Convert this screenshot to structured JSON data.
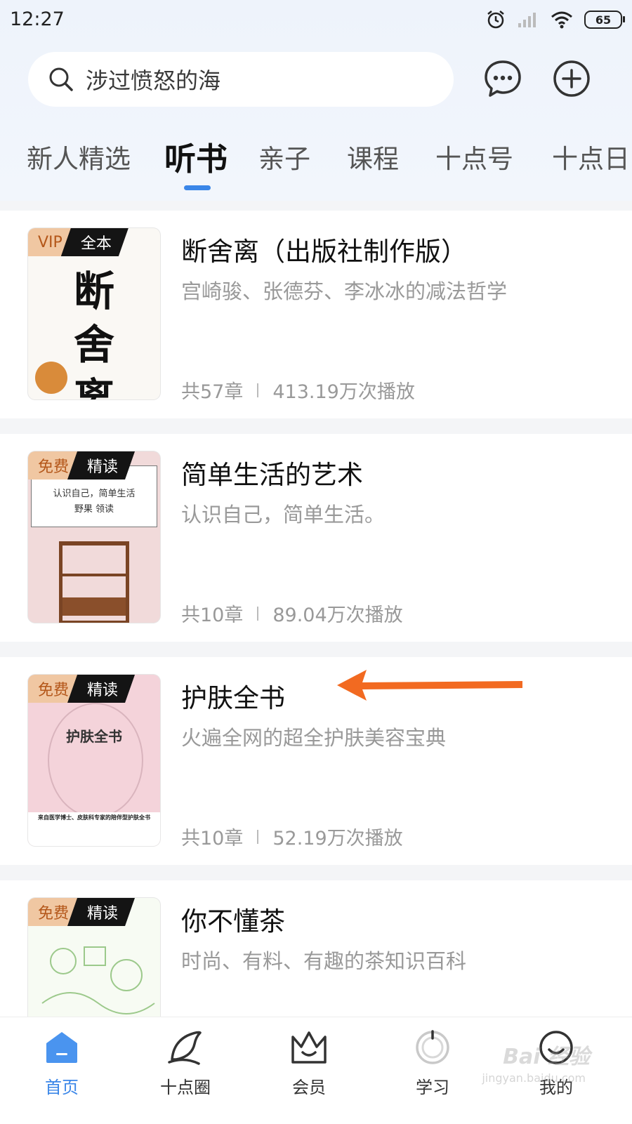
{
  "status_bar": {
    "time": "12:27",
    "battery": "65"
  },
  "search": {
    "placeholder": "涉过愤怒的海"
  },
  "tabs": [
    {
      "label": "新人精选"
    },
    {
      "label": "听书"
    },
    {
      "label": "亲子"
    },
    {
      "label": "课程"
    },
    {
      "label": "十点号"
    },
    {
      "label": "十点日"
    }
  ],
  "books": [
    {
      "title": "断舍离（出版社制作版）",
      "desc": "宫崎骏、张德芬、李冰冰的减法哲学",
      "chapters": "共57章",
      "plays": "413.19万次播放",
      "badge_left": "VIP",
      "badge_right": "全本",
      "cover_text": [
        "断",
        "舍",
        "离"
      ]
    },
    {
      "title": "简单生活的艺术",
      "desc": "认识自己，简单生活。",
      "chapters": "共10章",
      "plays": "89.04万次播放",
      "badge_left": "免费",
      "badge_right": "精读",
      "cover_text": [
        "认识自己，简单生活",
        "野果 领读"
      ]
    },
    {
      "title": "护肤全书",
      "desc": "火遍全网的超全护肤美容宝典",
      "chapters": "共10章",
      "plays": "52.19万次播放",
      "badge_left": "免费",
      "badge_right": "精读",
      "cover_text": [
        "护肤全书",
        "来自医学博士、皮肤科专家的陪伴型护肤全书"
      ]
    },
    {
      "title": "你不懂茶",
      "desc": "时尚、有料、有趣的茶知识百科",
      "badge_left": "免费",
      "badge_right": "精读"
    }
  ],
  "bottom_nav": [
    {
      "label": "首页",
      "icon": "home-icon"
    },
    {
      "label": "十点圈",
      "icon": "circle-feather-icon"
    },
    {
      "label": "会员",
      "icon": "crown-icon"
    },
    {
      "label": "学习",
      "icon": "study-ring-icon"
    },
    {
      "label": "我的",
      "icon": "profile-face-icon"
    }
  ],
  "watermark": {
    "main": "Bai 经验",
    "sub": "jingyan.baidu.com"
  },
  "colors": {
    "accent": "#3a86e8",
    "arrow": "#f26a21",
    "badge_vip_bg": "#f0c7a2"
  }
}
